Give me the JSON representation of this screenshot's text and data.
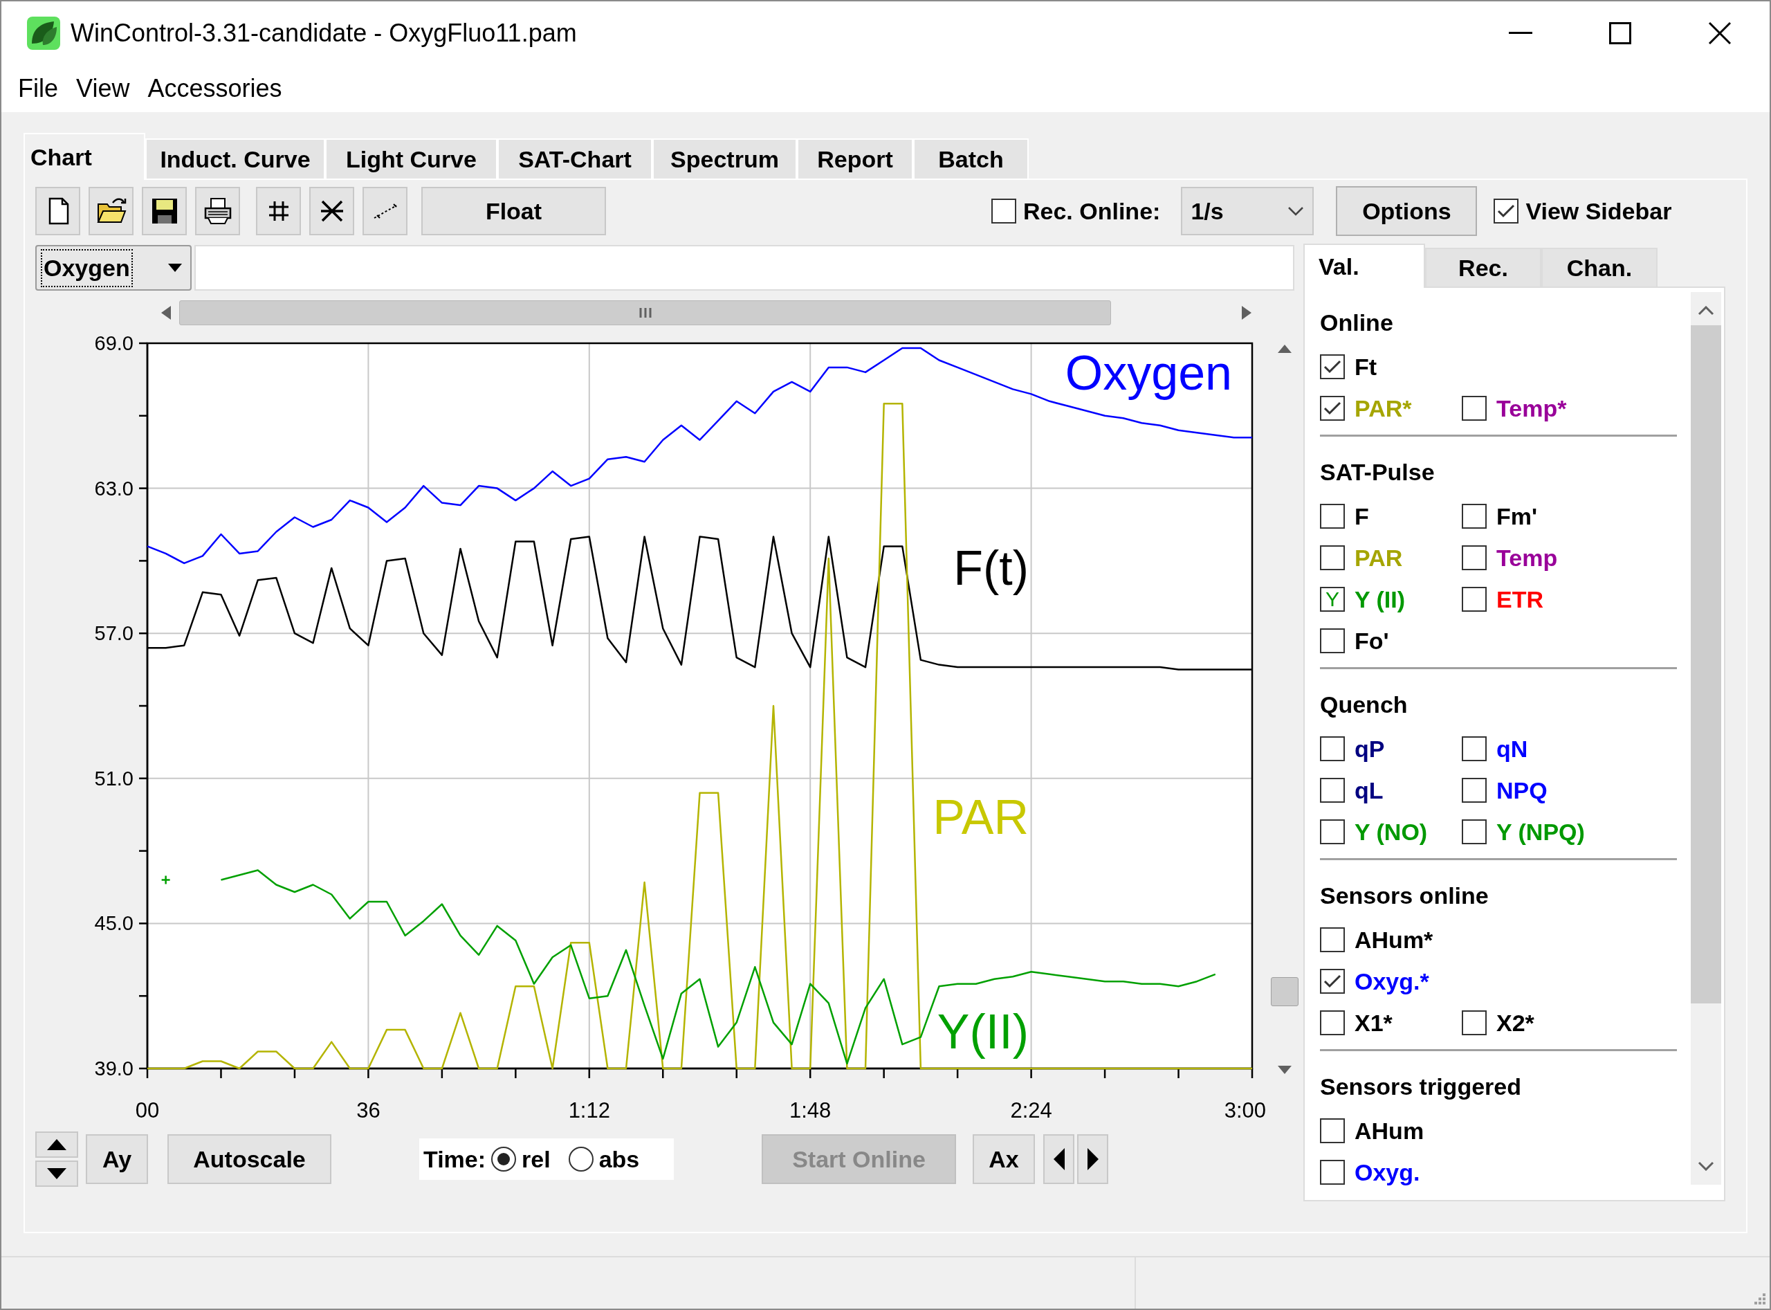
{
  "window": {
    "title": "WinControl-3.31-candidate - OxygFluo11.pam"
  },
  "menu": [
    "File",
    "View",
    "Accessories"
  ],
  "tabs": [
    {
      "label": "Chart",
      "selected": true
    },
    {
      "label": "Induct. Curve",
      "selected": false
    },
    {
      "label": "Light Curve",
      "selected": false
    },
    {
      "label": "SAT-Chart",
      "selected": false
    },
    {
      "label": "Spectrum",
      "selected": false
    },
    {
      "label": "Report",
      "selected": false
    },
    {
      "label": "Batch",
      "selected": false
    }
  ],
  "toolbar": {
    "float_button": "Float",
    "rec_online": {
      "label": "Rec. Online:",
      "checked": false
    },
    "interval": {
      "value": "1/s"
    },
    "options_button": "Options",
    "view_sidebar": {
      "label": "View Sidebar",
      "checked": true
    }
  },
  "chart_panel": {
    "channel_select": {
      "value": "Oxygen"
    },
    "chart_data": {
      "type": "line",
      "grid": true,
      "x": [
        0,
        3,
        6,
        9,
        12,
        15,
        18,
        21,
        24,
        27,
        30,
        33,
        36,
        39,
        42,
        45,
        48,
        51,
        54,
        57,
        60,
        63,
        66,
        69,
        72,
        75,
        78,
        81,
        84,
        87,
        90,
        93,
        96,
        99,
        102,
        105,
        108,
        111,
        114,
        117,
        120,
        123,
        126,
        129,
        132,
        135,
        138,
        141,
        144,
        147,
        150,
        153,
        156,
        159,
        162,
        165,
        168,
        171,
        174,
        177,
        180
      ],
      "ylim": [
        39,
        69
      ],
      "xlim": [
        0,
        180
      ],
      "yticks": [
        {
          "value": 39,
          "label": "39.0"
        },
        {
          "value": 45,
          "label": "45.0"
        },
        {
          "value": 51,
          "label": "51.0"
        },
        {
          "value": 57,
          "label": "57.0"
        },
        {
          "value": 63,
          "label": "63.0"
        },
        {
          "value": 69,
          "label": "69.0"
        }
      ],
      "xticks": [
        {
          "value": 0,
          "label": "00"
        },
        {
          "value": 36,
          "label": "36"
        },
        {
          "value": 72,
          "label": "1:12"
        },
        {
          "value": 108,
          "label": "1:48"
        },
        {
          "value": 144,
          "label": "2:24"
        },
        {
          "value": 180,
          "label": "3:00"
        }
      ],
      "series": [
        {
          "name": "Oxygen",
          "color": "#0000ff",
          "values": [
            60.6,
            60.3,
            59.9,
            60.2,
            61.1,
            60.3,
            60.4,
            61.2,
            61.8,
            61.4,
            61.7,
            62.5,
            62.2,
            61.6,
            62.2,
            63.1,
            62.4,
            62.3,
            63.1,
            63.0,
            62.5,
            63.0,
            63.7,
            63.1,
            63.4,
            64.2,
            64.3,
            64.1,
            65.0,
            65.6,
            65.0,
            65.8,
            66.6,
            66.1,
            67.0,
            67.4,
            67.0,
            68.0,
            68.0,
            67.8,
            68.3,
            68.8,
            68.8,
            68.3,
            68.0,
            67.7,
            67.4,
            67.1,
            66.9,
            66.6,
            66.4,
            66.2,
            66.0,
            65.9,
            65.7,
            65.6,
            65.4,
            65.3,
            65.2,
            65.1,
            65.1
          ]
        },
        {
          "name": "F(t)",
          "color": "#000000",
          "values": [
            56.4,
            56.4,
            56.5,
            58.7,
            58.6,
            56.9,
            59.2,
            59.3,
            57.0,
            56.6,
            59.7,
            57.2,
            56.5,
            60.0,
            60.1,
            57.0,
            56.1,
            60.5,
            57.5,
            56.0,
            60.8,
            60.8,
            56.5,
            60.9,
            61.0,
            56.8,
            55.8,
            61.0,
            57.2,
            55.7,
            61.0,
            60.9,
            56.0,
            55.6,
            61.0,
            57.0,
            55.6,
            61.0,
            56.0,
            55.6,
            60.6,
            60.6,
            55.9,
            55.7,
            55.6,
            55.6,
            55.6,
            55.6,
            55.6,
            55.6,
            55.6,
            55.6,
            55.6,
            55.6,
            55.6,
            55.6,
            55.5,
            55.5,
            55.5,
            55.5,
            55.5
          ]
        },
        {
          "name": "PAR",
          "color": "#b4b400",
          "values": [
            39.0,
            39.0,
            39.0,
            39.3,
            39.3,
            39.0,
            39.7,
            39.7,
            39.0,
            39.0,
            40.1,
            39.0,
            39.0,
            40.6,
            40.6,
            39.0,
            39.0,
            41.3,
            39.0,
            39.0,
            42.4,
            42.4,
            39.0,
            44.2,
            44.2,
            39.0,
            39.0,
            46.7,
            39.0,
            39.0,
            50.4,
            50.4,
            39.0,
            39.0,
            54.0,
            39.0,
            39.0,
            60.1,
            39.0,
            39.0,
            66.5,
            66.5,
            39.0,
            39.0,
            39.0,
            39.0,
            39.0,
            39.0,
            39.0,
            39.0,
            39.0,
            39.0,
            39.0,
            39.0,
            39.0,
            39.0,
            39.0,
            39.0,
            39.0,
            39.0,
            39.0
          ]
        },
        {
          "name": "Y(II)",
          "color": "#00a000",
          "values": [
            null,
            46.8,
            null,
            null,
            46.8,
            47.0,
            47.2,
            46.6,
            46.3,
            46.6,
            46.2,
            45.2,
            45.9,
            45.9,
            44.5,
            45.1,
            45.8,
            44.5,
            43.7,
            44.9,
            44.3,
            42.5,
            43.6,
            44.1,
            41.9,
            42.0,
            43.9,
            41.6,
            39.4,
            42.1,
            42.7,
            39.9,
            40.9,
            43.2,
            40.9,
            40.0,
            42.5,
            41.7,
            39.2,
            41.5,
            42.7,
            40.0,
            40.3,
            42.4,
            42.5,
            42.5,
            42.7,
            42.8,
            43.0,
            42.9,
            42.8,
            42.7,
            42.6,
            42.6,
            42.5,
            42.5,
            42.4,
            42.6,
            42.9,
            null,
            null
          ]
        }
      ]
    },
    "controls": {
      "ay_button": "Ay",
      "autoscale_button": "Autoscale",
      "time": {
        "label": "Time:",
        "options": [
          {
            "label": "rel",
            "selected": true
          },
          {
            "label": "abs",
            "selected": false
          }
        ]
      },
      "start_online_button": {
        "label": "Start Online",
        "disabled": true
      },
      "ax_button": "Ax"
    }
  },
  "sidebar": {
    "tabs": [
      {
        "label": "Val.",
        "selected": true
      },
      {
        "label": "Rec.",
        "selected": false
      },
      {
        "label": "Chan.",
        "selected": false
      }
    ],
    "sections": [
      {
        "title": "Online",
        "rows": [
          [
            {
              "label": "Ft",
              "checked": true,
              "color": "#000000"
            }
          ],
          [
            {
              "label": "PAR*",
              "checked": true,
              "color": "#a5a500"
            },
            {
              "label": "Temp*",
              "checked": false,
              "color": "#990099"
            }
          ]
        ]
      },
      {
        "title": "SAT-Pulse",
        "rows": [
          [
            {
              "label": "F",
              "checked": false,
              "color": "#000000"
            },
            {
              "label": "Fm'",
              "checked": false,
              "color": "#000000"
            }
          ],
          [
            {
              "label": "PAR",
              "checked": false,
              "color": "#a5a500"
            },
            {
              "label": "Temp",
              "checked": false,
              "color": "#990099"
            }
          ],
          [
            {
              "label": "Y (II)",
              "checked": true,
              "mark": "Y",
              "color": "#009900"
            },
            {
              "label": "ETR",
              "checked": false,
              "color": "#ff0000"
            }
          ],
          [
            {
              "label": "Fo'",
              "checked": false,
              "color": "#000000"
            }
          ]
        ]
      },
      {
        "title": "Quench",
        "rows": [
          [
            {
              "label": "qP",
              "checked": false,
              "color": "#000080"
            },
            {
              "label": "qN",
              "checked": false,
              "color": "#0000ff"
            }
          ],
          [
            {
              "label": "qL",
              "checked": false,
              "color": "#000080"
            },
            {
              "label": "NPQ",
              "checked": false,
              "color": "#0000ff"
            }
          ],
          [
            {
              "label": "Y (NO)",
              "checked": false,
              "color": "#009900"
            },
            {
              "label": "Y (NPQ)",
              "checked": false,
              "color": "#009900"
            }
          ]
        ]
      },
      {
        "title": "Sensors online",
        "rows": [
          [
            {
              "label": "AHum*",
              "checked": false,
              "color": "#000000"
            }
          ],
          [
            {
              "label": "Oxyg.*",
              "checked": true,
              "color": "#0000ff"
            }
          ],
          [
            {
              "label": "X1*",
              "checked": false,
              "color": "#000000"
            },
            {
              "label": "X2*",
              "checked": false,
              "color": "#000000"
            }
          ]
        ]
      },
      {
        "title": "Sensors triggered",
        "rows": [
          [
            {
              "label": "AHum",
              "checked": false,
              "color": "#000000"
            }
          ],
          [
            {
              "label": "Oxyg.",
              "checked": false,
              "color": "#0000ff"
            }
          ]
        ]
      }
    ]
  }
}
